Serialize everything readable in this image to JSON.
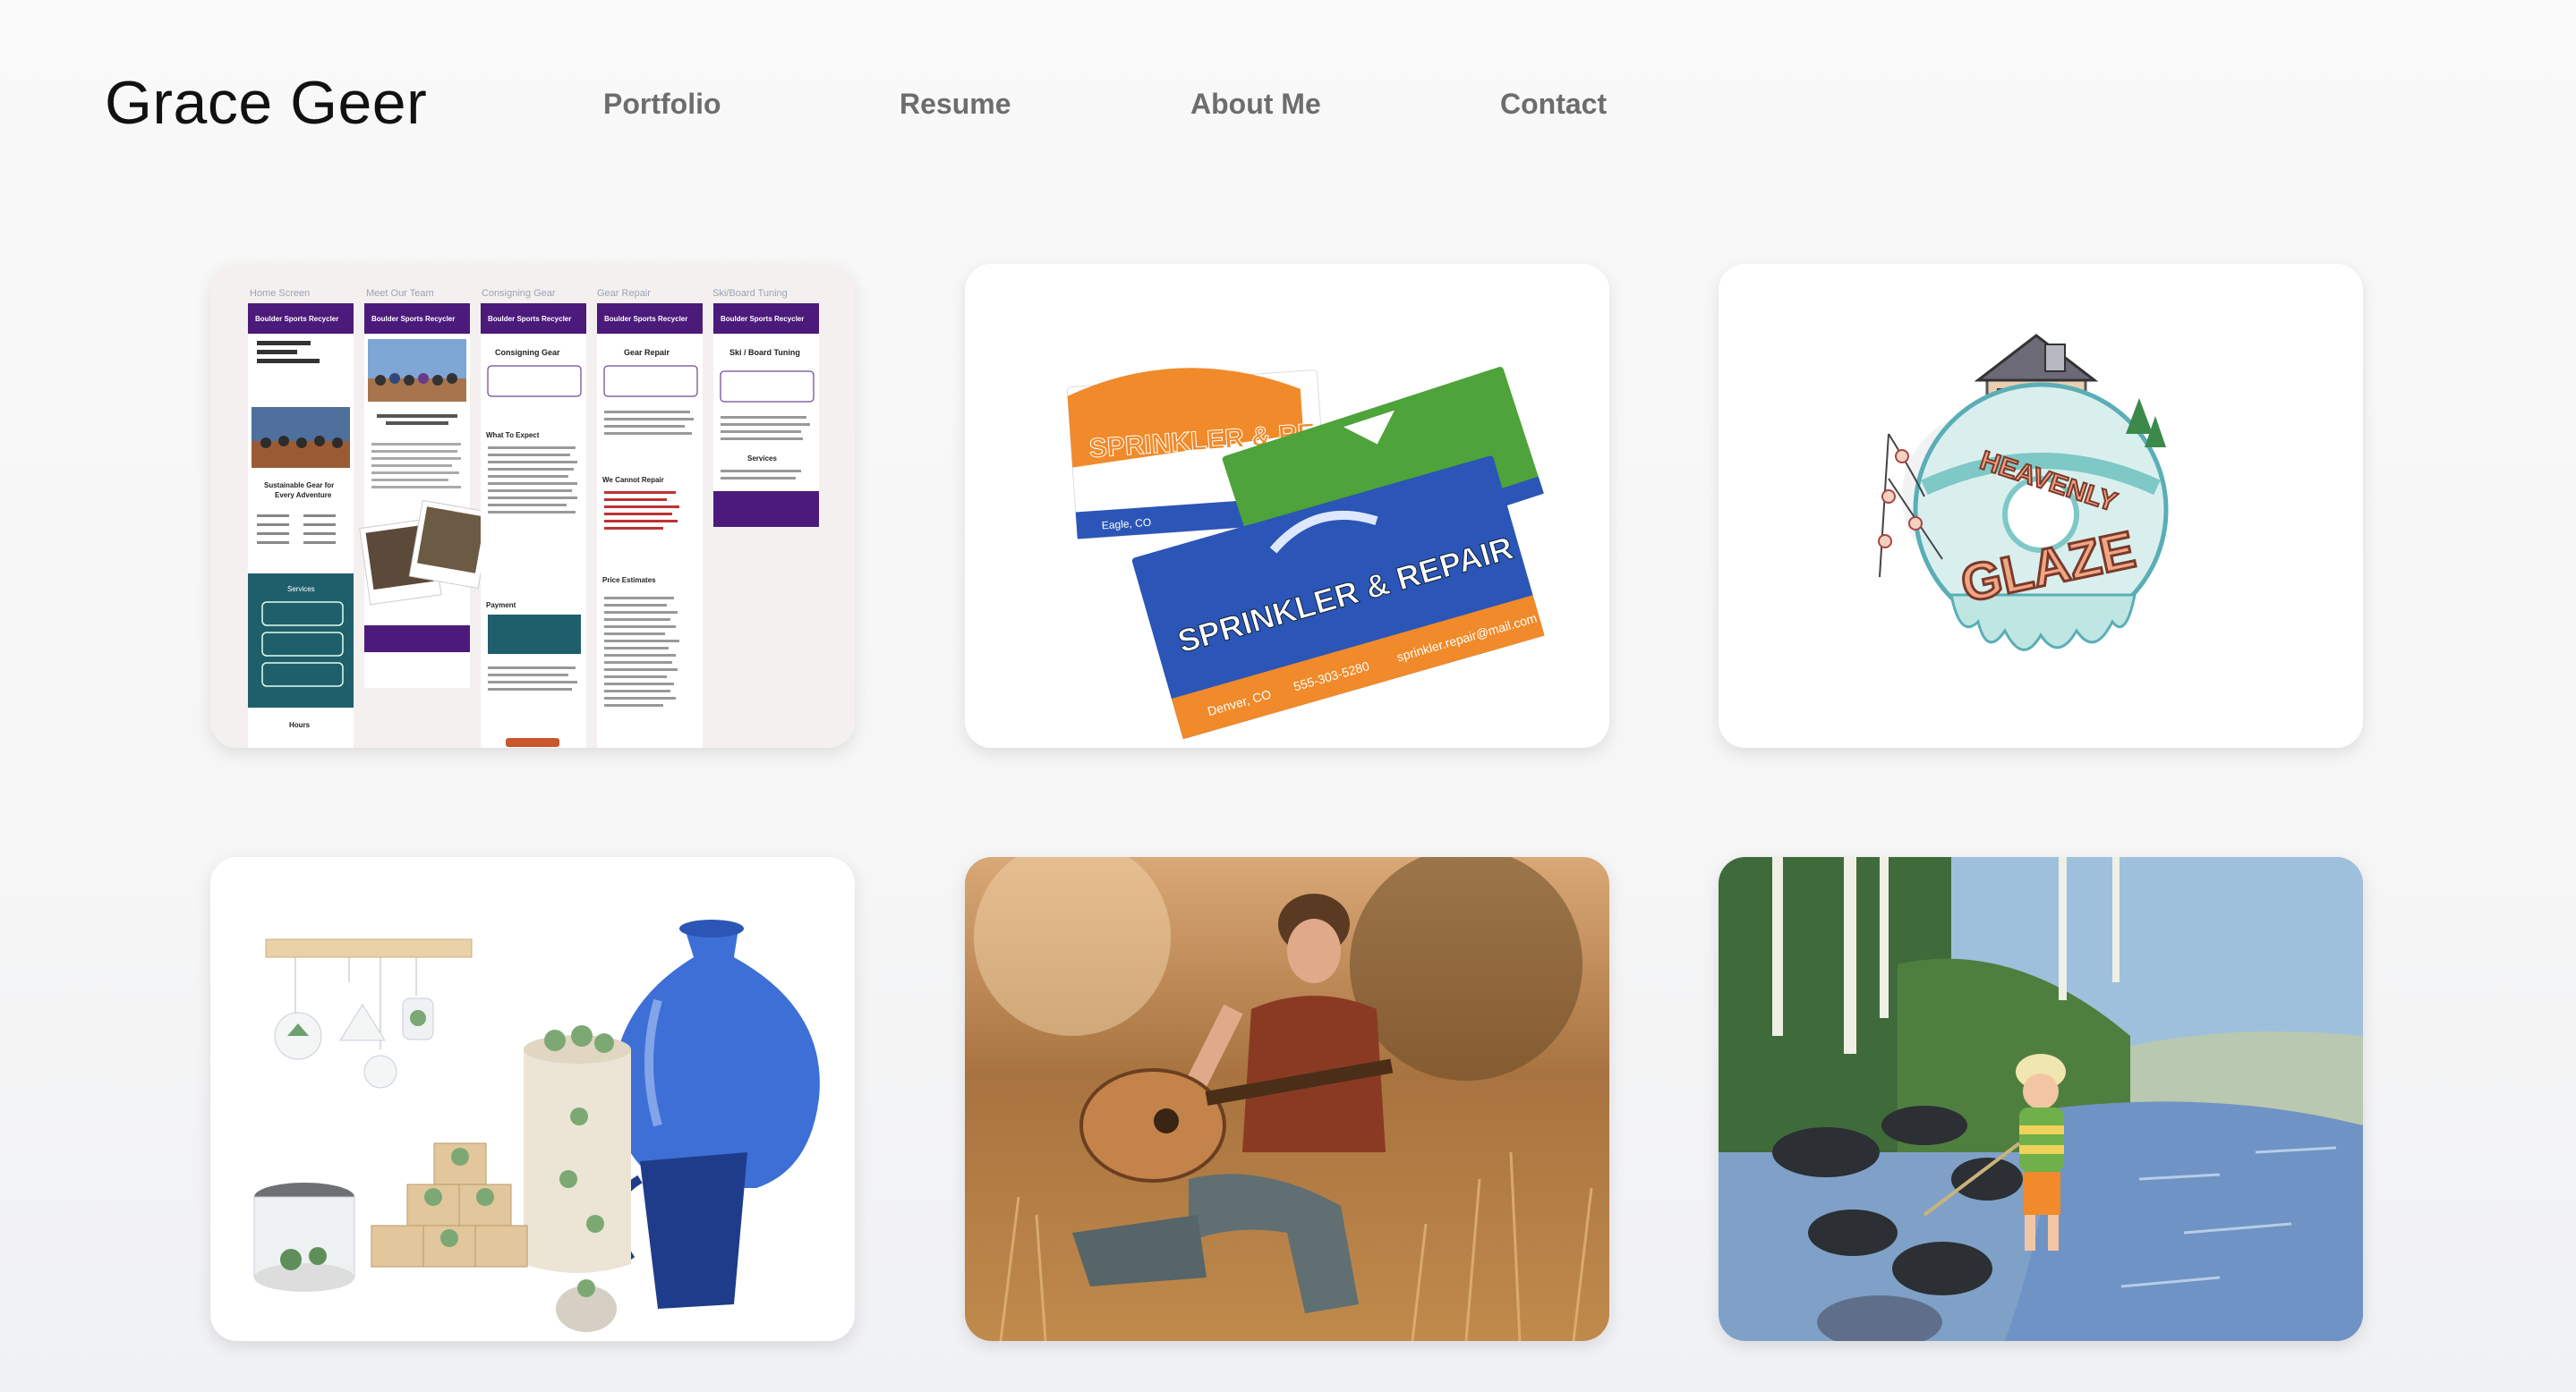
{
  "site": {
    "title": "Grace Geer"
  },
  "nav": {
    "items": [
      {
        "label": "Portfolio"
      },
      {
        "label": "Resume"
      },
      {
        "label": "About Me"
      },
      {
        "label": "Contact"
      }
    ]
  },
  "portfolio": {
    "card1": {
      "screen_labels": [
        "Home Screen",
        "Meet Our Team",
        "Consigning Gear",
        "Gear Repair",
        "Ski/Board Tuning"
      ],
      "brand": "Boulder Sports Recycler",
      "headings": {
        "consigning": "Consigning Gear",
        "repair": "Gear Repair",
        "tuning": "Ski / Board Tuning",
        "sustainable": "Sustainable Gear for Every Adventure",
        "services": "Services",
        "what_to_expect": "What To Expect",
        "we_cannot_repair": "We Cannot Repair",
        "price_estimates": "Price Estimates",
        "payment": "Payment",
        "hours": "Hours"
      }
    },
    "card2": {
      "brand": "SPRINKLER & REPAIR",
      "back_brand": "SPRINKLER & RE",
      "location": "Eagle, CO",
      "city": "Denver, CO",
      "phone": "555-303-5280",
      "email": "sprinkler.repair@mail.com"
    },
    "card3": {
      "logo_line1": "HEAVENLY",
      "logo_line2": "GLAZE"
    }
  },
  "colors": {
    "nav_text": "#6d6d6d",
    "title_text": "#111111",
    "brand_purple": "#4b1a7a",
    "card_orange": "#f08a2a",
    "card_blue": "#2b55b6",
    "card_green": "#4ea33a",
    "teal": "#1f5f6b"
  }
}
